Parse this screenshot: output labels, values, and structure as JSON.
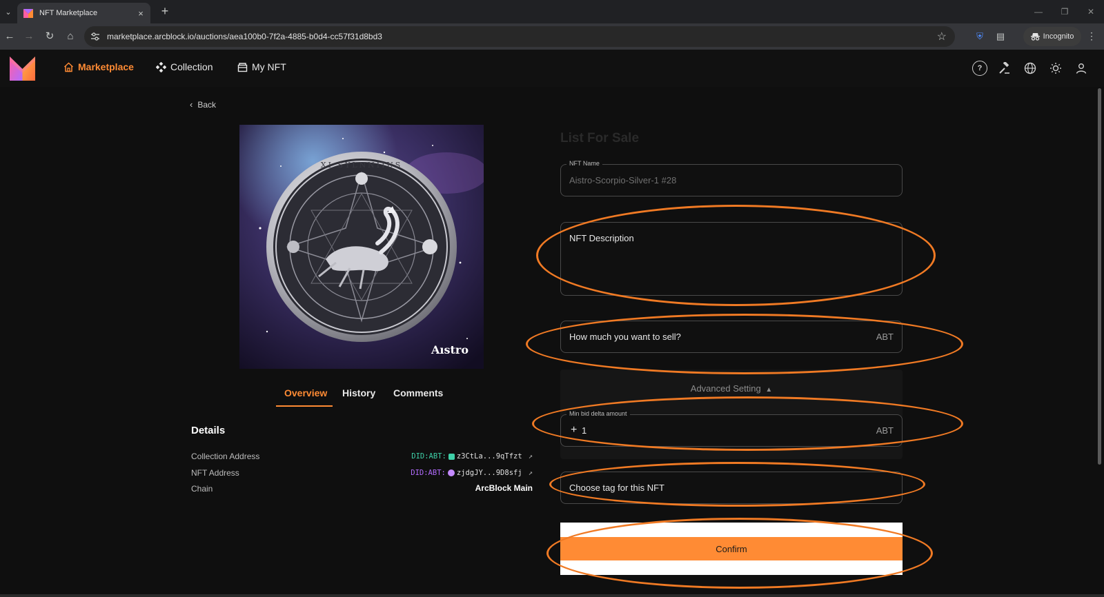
{
  "browser": {
    "tab_title": "NFT Marketplace",
    "tab_close": "×",
    "new_tab": "+",
    "url": "marketplace.arcblock.io/auctions/aea100b0-7f2a-4885-b0d4-cc57f31d8bd3",
    "incognito_label": "Incognito"
  },
  "header": {
    "nav": [
      {
        "label": "Marketplace",
        "icon": "home-icon",
        "active": true
      },
      {
        "label": "Collection",
        "icon": "collection-icon",
        "active": false
      },
      {
        "label": "My NFT",
        "icon": "wallet-icon",
        "active": false
      }
    ],
    "icons": [
      "help-icon",
      "auction-icon",
      "globe-icon",
      "theme-icon",
      "user-icon"
    ]
  },
  "left": {
    "back_label": "Back",
    "image_watermark": "Aıstro",
    "image_coin_text": "XI SYLNNIIUS",
    "tabs": [
      "Overview",
      "History",
      "Comments"
    ],
    "details_title": "Details",
    "details": [
      {
        "label": "Collection Address",
        "prefix": "DID:ABT:",
        "value": "z3CtLa...9qTfzt"
      },
      {
        "label": "NFT Address",
        "prefix": "DID:ABT:",
        "value": "zjdgJY...9D8sfj"
      },
      {
        "label": "Chain",
        "value": "ArcBlock Main"
      }
    ]
  },
  "form": {
    "title": "List For Sale",
    "nft_name_label": "NFT Name",
    "nft_name_value": "Aistro-Scorpio-Silver-1 #28",
    "description_placeholder": "NFT Description",
    "price_placeholder": "How much you want to sell?",
    "currency": "ABT",
    "advanced_label": "Advanced Setting",
    "min_bid_label": "Min bid delta amount",
    "min_bid_value": "1",
    "tag_placeholder": "Choose tag for this NFT",
    "confirm_label": "Confirm"
  },
  "colors": {
    "accent": "#ff8b34",
    "annotation": "#f07a24",
    "background": "#0f0f0f"
  }
}
